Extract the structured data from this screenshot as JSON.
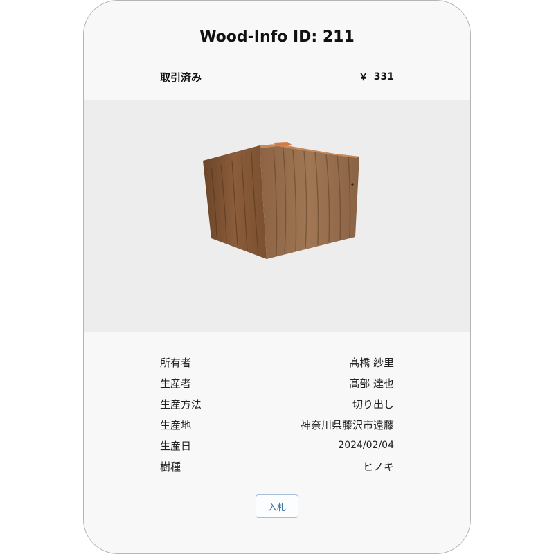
{
  "card": {
    "title": "Wood-Info ID: 211",
    "status": "取引済み",
    "currency_symbol": "￥",
    "price": "331"
  },
  "image": {
    "subject": "wood-block",
    "colors": {
      "background": "#ededed",
      "wood_light": "#9a6c48",
      "wood_dark": "#5b3a22"
    }
  },
  "details": [
    {
      "label": "所有者",
      "value": "髙橋 紗里"
    },
    {
      "label": "生産者",
      "value": "髙部 達也"
    },
    {
      "label": "生産方法",
      "value": "切り出し"
    },
    {
      "label": "生産地",
      "value": "神奈川県藤沢市遠藤"
    },
    {
      "label": "生産日",
      "value": "2024/02/04"
    },
    {
      "label": "樹種",
      "value": "ヒノキ"
    }
  ],
  "actions": {
    "bid_label": "入札",
    "accent": "#3a6ea5"
  }
}
